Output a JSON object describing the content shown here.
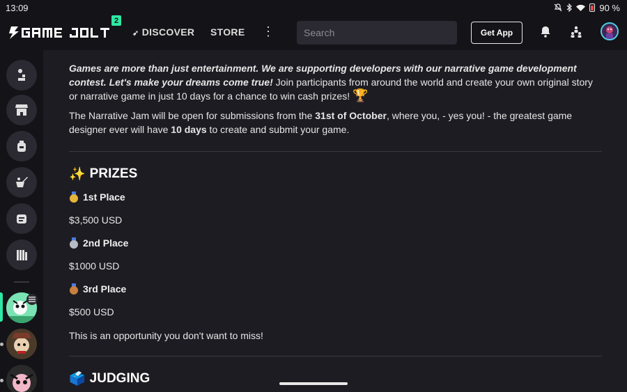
{
  "status_bar": {
    "time": "13:09",
    "battery": "90 %"
  },
  "nav": {
    "notification_count": "2",
    "discover_label": "DISCOVER",
    "store_label": "STORE",
    "more_label": "⋮",
    "search_placeholder": "Search",
    "get_app_label": "Get App"
  },
  "intro": {
    "line1_bold_italic": "Games are more than just entertainment. We are supporting developers with our narrative game development contest.",
    "line2_bold_italic": "Let's make your dreams come true!",
    "line2_rest": " Join participants from around the world and create your own original story or narrative game in just 10 days for a chance to win cash prizes! ",
    "trophy": "🏆",
    "para2_a": "The Narrative Jam will be open for submissions from the ",
    "para2_b": "31st of October",
    "para2_c": ", where you, - yes you! - the greatest game designer ever will have ",
    "para2_d": "10 days",
    "para2_e": " to create and submit your game."
  },
  "prizes": {
    "emoji": "✨",
    "heading": "PRIZES",
    "items": [
      {
        "place": "1st Place",
        "amount": "$3,500 USD",
        "medal_color": "#e7b53a"
      },
      {
        "place": "2nd Place",
        "amount": "$1000 USD",
        "medal_color": "#b8bcc4"
      },
      {
        "place": "3rd Place",
        "amount": "$500 USD",
        "medal_color": "#c9803f"
      }
    ],
    "closing": "This is an opportunity you don't want to miss!"
  },
  "judging": {
    "emoji": "🗳️",
    "heading": "JUDGING"
  },
  "colors": {
    "accent": "#2ee8a5",
    "background": "#1e1c23",
    "nav_bg": "#141317"
  }
}
